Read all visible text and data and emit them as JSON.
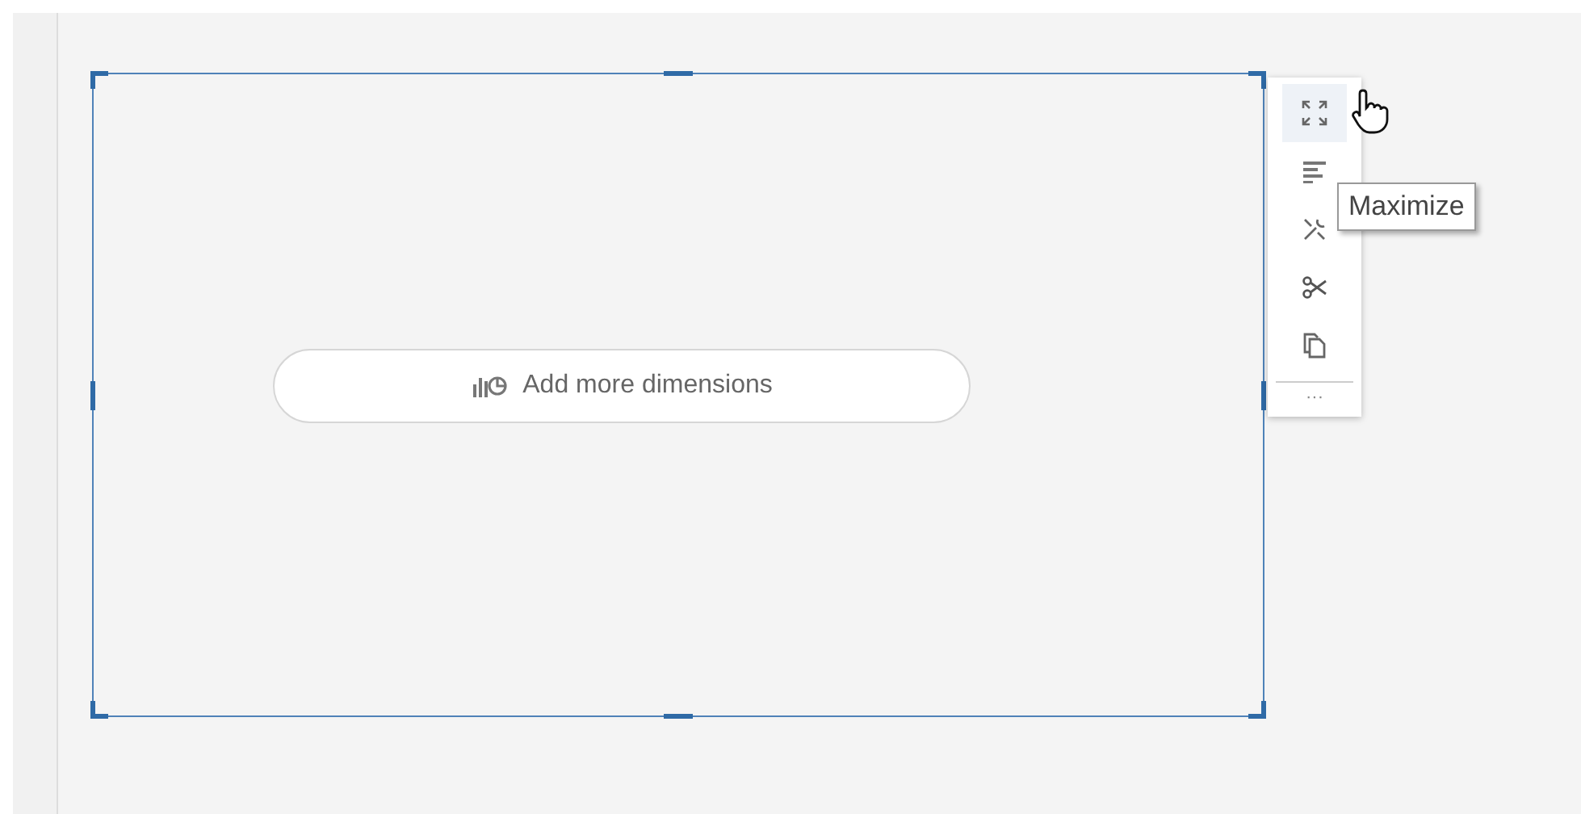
{
  "canvas": {
    "widget": {
      "selected": true,
      "button": {
        "label": "Add more dimensions"
      }
    }
  },
  "toolbar": {
    "items": [
      {
        "kind": "maximize",
        "hovered": true
      },
      {
        "kind": "sort",
        "hovered": false
      },
      {
        "kind": "tools",
        "hovered": false
      },
      {
        "kind": "cut",
        "hovered": false
      },
      {
        "kind": "copy",
        "hovered": false
      }
    ],
    "more": "···"
  },
  "tooltip": "Maximize"
}
